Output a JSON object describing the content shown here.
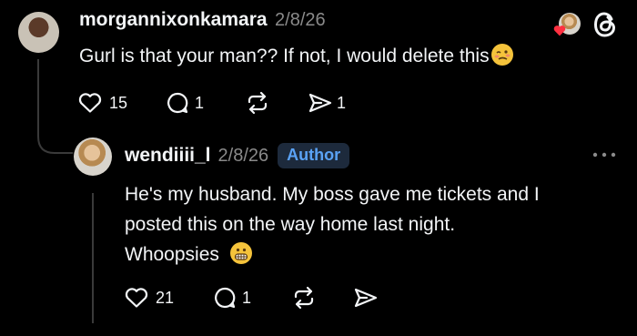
{
  "comment": {
    "username": "morgannixonkamara",
    "date": "2/8/26",
    "text": "Gurl is that your man?? If not, I would delete this",
    "emoji": "woozy-face",
    "likes": "15",
    "replies": "1",
    "shares": "1"
  },
  "reply": {
    "username": "wendiiii_l",
    "date": "2/8/26",
    "badge": "Author",
    "line1": "He's my husband. My boss gave me tickets and I",
    "line2": "posted this on the way home last night.",
    "line3": "Whoopsies",
    "emoji": "grimacing-face",
    "likes": "21",
    "replies": "1"
  },
  "colors": {
    "background": "#000000",
    "text": "#f3f5f7",
    "muted": "#8a8a8a",
    "author_badge_bg": "#1d2a3c",
    "author_badge_text": "#5aa2f5",
    "like_heart": "#ff3040"
  },
  "icons": [
    "heart-icon",
    "comment-icon",
    "repost-icon",
    "share-icon",
    "threads-logo-icon",
    "more-icon"
  ]
}
